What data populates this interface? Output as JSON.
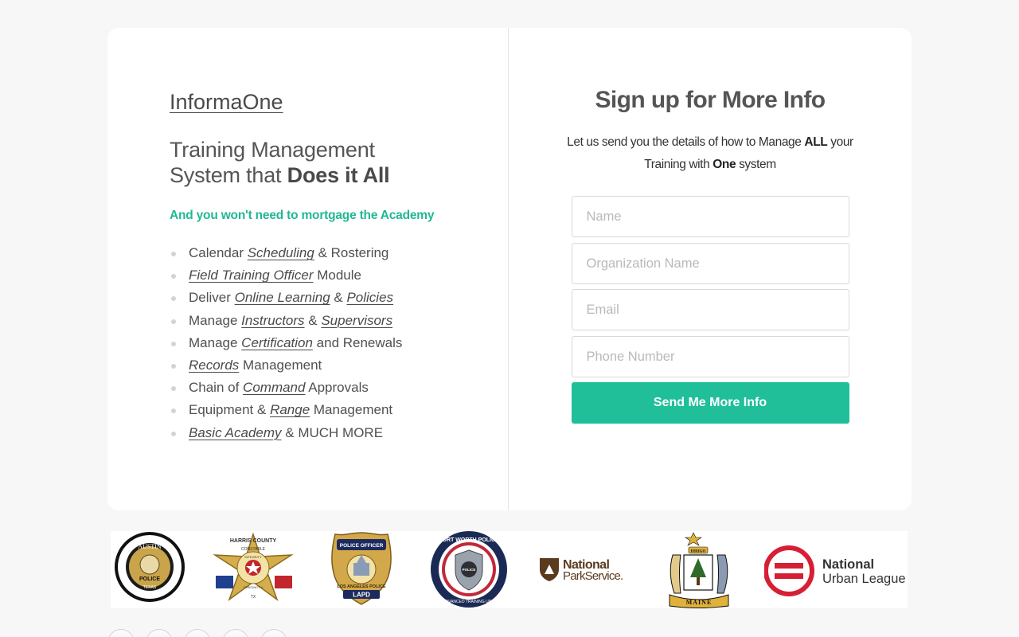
{
  "brand": "InformaOne",
  "headline": {
    "line1": "Training Management",
    "line2_prefix": "System that ",
    "line2_bold": "Does it All"
  },
  "tagline": "And you won't need to mortgage the Academy",
  "features": [
    [
      {
        "t": "Calendar "
      },
      {
        "t": "Scheduling",
        "em": true
      },
      {
        "t": " & Rostering"
      }
    ],
    [
      {
        "t": "Field Training Officer",
        "em": true
      },
      {
        "t": " Module"
      }
    ],
    [
      {
        "t": "Deliver "
      },
      {
        "t": "Online Learning",
        "em": true
      },
      {
        "t": " & "
      },
      {
        "t": "Policies",
        "em": true
      }
    ],
    [
      {
        "t": "Manage "
      },
      {
        "t": "Instructors",
        "em": true
      },
      {
        "t": " & "
      },
      {
        "t": "Supervisors",
        "em": true
      }
    ],
    [
      {
        "t": "Manage "
      },
      {
        "t": "Certification",
        "em": true
      },
      {
        "t": " and Renewals"
      }
    ],
    [
      {
        "t": "Records",
        "em": true
      },
      {
        "t": " Management"
      }
    ],
    [
      {
        "t": "Chain of "
      },
      {
        "t": "Command",
        "em": true
      },
      {
        "t": " Approvals"
      }
    ],
    [
      {
        "t": "Equipment & "
      },
      {
        "t": "Range",
        "em": true
      },
      {
        "t": " Management"
      }
    ],
    [
      {
        "t": "Basic Academy",
        "em": true
      },
      {
        "t": " & MUCH MORE"
      }
    ]
  ],
  "form": {
    "title": "Sign up for More Info",
    "desc_a": "Let us send you the details of how to Manage ",
    "desc_b": "ALL",
    "desc_c": " your Training with ",
    "desc_d": "One",
    "desc_e": " system",
    "name_placeholder": "Name",
    "org_placeholder": "Organization Name",
    "email_placeholder": "Email",
    "phone_placeholder": "Phone Number",
    "submit_label": "Send Me More Info"
  },
  "logos": {
    "austin_top": "AUSTIN",
    "austin_mid": "POLICE",
    "austin_bottom": "TEXAS",
    "harris_arc": "HARRIS COUNTY",
    "harris_constable": "CONSTABLE",
    "harris_integrity": "INTEGRITY",
    "harris_precinct": "PRECINCT 4",
    "harris_tx": "TX",
    "lapd_top": "POLICE OFFICER",
    "lapd_arc": "LOS ANGELES POLICE",
    "lapd_bottom": "LAPD",
    "fw_top": "FORT WORTH POLICE",
    "fw_bottom": "ADVANCED TRAINING UNIT",
    "fw_center": "POLICE",
    "nps_line1": "National",
    "nps_line2": "ParkService.",
    "maine_text": "MAINE",
    "maine_top": "DIRIGO",
    "nul_line1": "National",
    "nul_line2": "Urban League"
  },
  "colors": {
    "accent": "#20bf9a",
    "tagline": "#20b894",
    "nul_red": "#d71f34",
    "nps_brown": "#5b3b1e"
  }
}
